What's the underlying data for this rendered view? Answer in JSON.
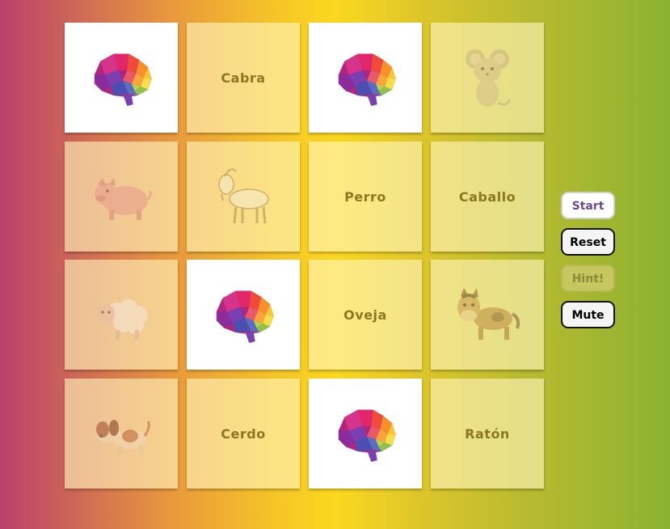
{
  "cards": [
    {
      "state": "back"
    },
    {
      "state": "word",
      "text": "Cabra"
    },
    {
      "state": "back"
    },
    {
      "state": "picture",
      "icon": "mouse-icon"
    },
    {
      "state": "picture",
      "icon": "pig-icon"
    },
    {
      "state": "picture",
      "icon": "goat-icon"
    },
    {
      "state": "word",
      "text": "Perro"
    },
    {
      "state": "word",
      "text": "Caballo"
    },
    {
      "state": "picture",
      "icon": "sheep-icon"
    },
    {
      "state": "back"
    },
    {
      "state": "word",
      "text": "Oveja"
    },
    {
      "state": "picture",
      "icon": "horse-icon"
    },
    {
      "state": "picture",
      "icon": "dog-icon"
    },
    {
      "state": "word",
      "text": "Cerdo"
    },
    {
      "state": "back"
    },
    {
      "state": "word",
      "text": "Ratón"
    }
  ],
  "card_back_icon": "brain-icon",
  "controls": {
    "start_label": "Start",
    "reset_label": "Reset",
    "hint_label": "Hint!",
    "mute_label": "Mute"
  },
  "colors": {
    "background_left": "#bb3f6e",
    "background_center": "#fbd81f",
    "background_right": "#8bb231",
    "hint_disabled": "#c7c760",
    "start_text": "#6a4d97"
  }
}
